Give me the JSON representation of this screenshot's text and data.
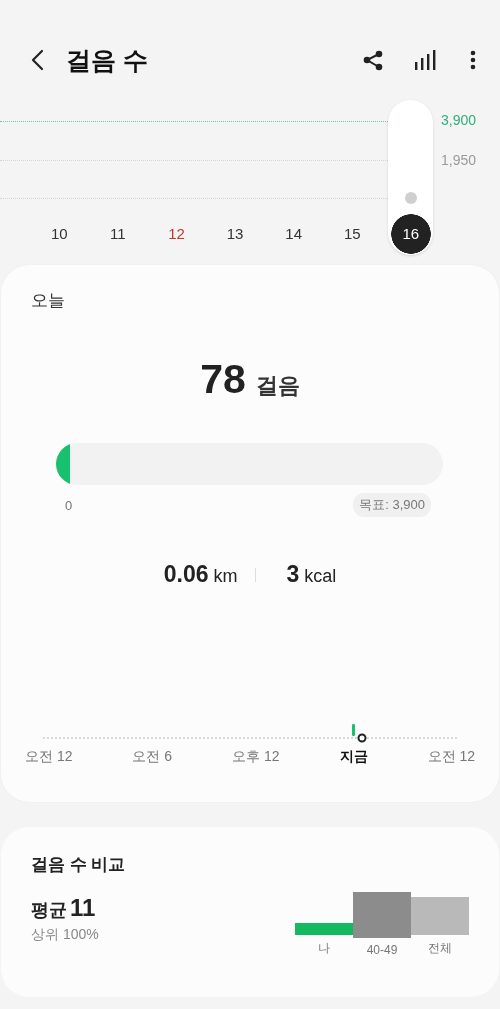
{
  "header": {
    "title": "걸음 수"
  },
  "week_chart": {
    "goal_label": "3,900",
    "mid_label": "1,950",
    "days": [
      {
        "label": "10",
        "selected": false,
        "color": "#333333"
      },
      {
        "label": "11",
        "selected": false,
        "color": "#333333"
      },
      {
        "label": "12",
        "selected": false,
        "color": "#c0392b"
      },
      {
        "label": "13",
        "selected": false,
        "color": "#333333"
      },
      {
        "label": "14",
        "selected": false,
        "color": "#333333"
      },
      {
        "label": "15",
        "selected": false,
        "color": "#333333"
      },
      {
        "label": "16",
        "selected": true,
        "color": "#ffffff"
      }
    ]
  },
  "today": {
    "title": "오늘",
    "steps": "78",
    "steps_unit": "걸음",
    "level": 0.02,
    "start_label": "0",
    "goal": "목표: 3,900",
    "distance": "0.06",
    "distance_unit": "km",
    "calories": "3",
    "calories_unit": "kcal",
    "timeline": [
      {
        "label": "오전 12",
        "current": false
      },
      {
        "label": "오전 6",
        "current": false
      },
      {
        "label": "오후 12",
        "current": false
      },
      {
        "label": "지금",
        "current": true
      },
      {
        "label": "오전 12",
        "current": false
      }
    ]
  },
  "comparison": {
    "title": "걸음 수 비교",
    "average_label": "평균",
    "average_value": "11",
    "rank": "상위 100%",
    "bars": [
      {
        "label": "나",
        "color": "#12b95e"
      },
      {
        "label": "40-49",
        "color": "#8c8c8c"
      },
      {
        "label": "전체",
        "color": "#b9b9b9"
      }
    ]
  }
}
